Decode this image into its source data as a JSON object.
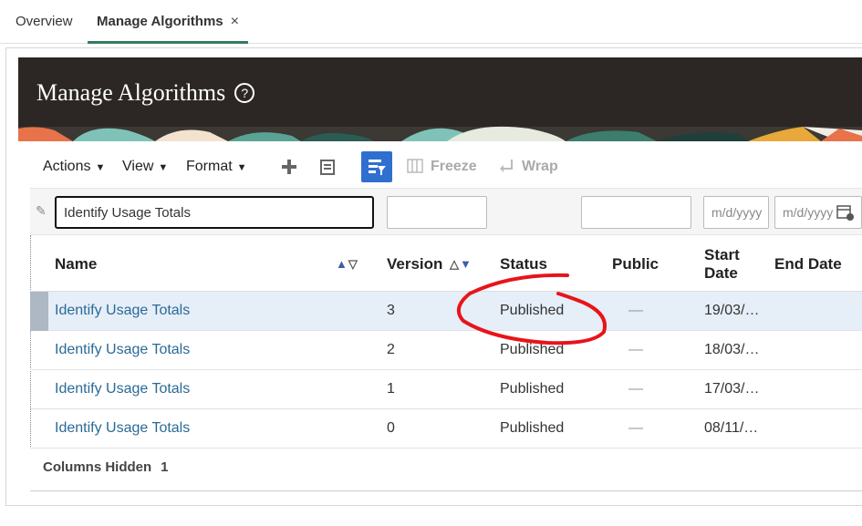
{
  "tabs": [
    {
      "label": "Overview"
    },
    {
      "label": "Manage Algorithms",
      "close": "×"
    }
  ],
  "banner": {
    "title": "Manage Algorithms",
    "help_glyph": "?"
  },
  "toolbar": {
    "actions": "Actions",
    "view": "View",
    "format": "Format",
    "dropdown_glyph": "▼",
    "freeze": "Freeze",
    "wrap": "Wrap"
  },
  "filters": {
    "name": "Identify Usage Totals",
    "start_date_placeholder": "m/d/yyyy",
    "end_date_placeholder": "m/d/yyyy"
  },
  "columns": {
    "name": "Name",
    "version": "Version",
    "status": "Status",
    "public": "Public",
    "start_date_1": "Start",
    "start_date_2": "Date",
    "end_date": "End Date"
  },
  "rows": [
    {
      "name": "Identify Usage Totals",
      "version": "3",
      "status": "Published",
      "public": "—",
      "start": "19/03/…"
    },
    {
      "name": "Identify Usage Totals",
      "version": "2",
      "status": "Published",
      "public": "—",
      "start": "18/03/…"
    },
    {
      "name": "Identify Usage Totals",
      "version": "1",
      "status": "Published",
      "public": "—",
      "start": "17/03/…"
    },
    {
      "name": "Identify Usage Totals",
      "version": "0",
      "status": "Published",
      "public": "—",
      "start": "08/11/…"
    }
  ],
  "footer": {
    "label": "Columns Hidden",
    "count": "1"
  },
  "colors": {
    "accent": "#317d5c",
    "banner": "#2c2724",
    "link": "#2a6a96",
    "annotation": "#e8141b"
  }
}
